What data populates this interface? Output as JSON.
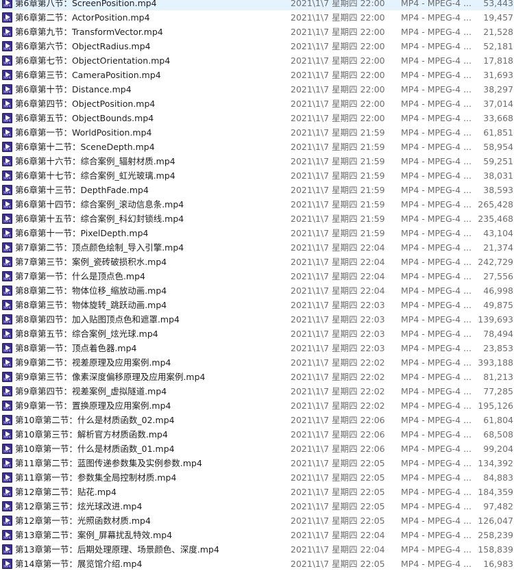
{
  "files": [
    {
      "name": "第6章第八节：ScreenPosition.mp4",
      "date": "2021\\1\\7 星期四 22:00",
      "type": "MP4 - MPEG-4 ...",
      "size": "53,443"
    },
    {
      "name": "第6章第二节：ActorPosition.mp4",
      "date": "2021\\1\\7 星期四 22:00",
      "type": "MP4 - MPEG-4 ...",
      "size": "19,457"
    },
    {
      "name": "第6章第九节：TransformVector.mp4",
      "date": "2021\\1\\7 星期四 22:00",
      "type": "MP4 - MPEG-4 ...",
      "size": "21,528"
    },
    {
      "name": "第6章第六节：ObjectRadius.mp4",
      "date": "2021\\1\\7 星期四 22:00",
      "type": "MP4 - MPEG-4 ...",
      "size": "52,181"
    },
    {
      "name": "第6章第七节：ObjectOrientation.mp4",
      "date": "2021\\1\\7 星期四 22:00",
      "type": "MP4 - MPEG-4 ...",
      "size": "17,818"
    },
    {
      "name": "第6章第三节：CameraPosition.mp4",
      "date": "2021\\1\\7 星期四 22:00",
      "type": "MP4 - MPEG-4 ...",
      "size": "31,693"
    },
    {
      "name": "第6章第十节：Distance.mp4",
      "date": "2021\\1\\7 星期四 22:00",
      "type": "MP4 - MPEG-4 ...",
      "size": "38,297"
    },
    {
      "name": "第6章第四节：ObjectPosition.mp4",
      "date": "2021\\1\\7 星期四 22:00",
      "type": "MP4 - MPEG-4 ...",
      "size": "37,014"
    },
    {
      "name": "第6章第五节：ObjectBounds.mp4",
      "date": "2021\\1\\7 星期四 22:00",
      "type": "MP4 - MPEG-4 ...",
      "size": "33,668"
    },
    {
      "name": "第6章第一节：WorldPosition.mp4",
      "date": "2021\\1\\7 星期四 21:59",
      "type": "MP4 - MPEG-4 ...",
      "size": "61,851"
    },
    {
      "name": "第6章第十二节：SceneDepth.mp4",
      "date": "2021\\1\\7 星期四 21:59",
      "type": "MP4 - MPEG-4 ...",
      "size": "58,954"
    },
    {
      "name": "第6章第十六节：综合案例_辐射材质.mp4",
      "date": "2021\\1\\7 星期四 21:59",
      "type": "MP4 - MPEG-4 ...",
      "size": "59,251"
    },
    {
      "name": "第6章第十七节：综合案例_虹光玻璃.mp4",
      "date": "2021\\1\\7 星期四 21:59",
      "type": "MP4 - MPEG-4 ...",
      "size": "38,031"
    },
    {
      "name": "第6章第十三节：DepthFade.mp4",
      "date": "2021\\1\\7 星期四 21:59",
      "type": "MP4 - MPEG-4 ...",
      "size": "38,593"
    },
    {
      "name": "第6章第十四节：综合案例_滚动信息条.mp4",
      "date": "2021\\1\\7 星期四 21:59",
      "type": "MP4 - MPEG-4 ...",
      "size": "265,428"
    },
    {
      "name": "第6章第十五节：综合案例_科幻封锁线.mp4",
      "date": "2021\\1\\7 星期四 21:59",
      "type": "MP4 - MPEG-4 ...",
      "size": "235,468"
    },
    {
      "name": "第6章第十一节：PixelDepth.mp4",
      "date": "2021\\1\\7 星期四 21:59",
      "type": "MP4 - MPEG-4 ...",
      "size": "43,104"
    },
    {
      "name": "第7章第二节：顶点颜色绘制_导入引擎.mp4",
      "date": "2021\\1\\7 星期四 22:04",
      "type": "MP4 - MPEG-4 ...",
      "size": "21,374"
    },
    {
      "name": "第7章第三节：案例_瓷砖破损积水.mp4",
      "date": "2021\\1\\7 星期四 22:04",
      "type": "MP4 - MPEG-4 ...",
      "size": "242,729"
    },
    {
      "name": "第7章第一节：什么是顶点色.mp4",
      "date": "2021\\1\\7 星期四 22:04",
      "type": "MP4 - MPEG-4 ...",
      "size": "27,556"
    },
    {
      "name": "第8章第二节：物体位移_缩放动画.mp4",
      "date": "2021\\1\\7 星期四 22:04",
      "type": "MP4 - MPEG-4 ...",
      "size": "46,998"
    },
    {
      "name": "第8章第三节：物体旋转_跳跃动画.mp4",
      "date": "2021\\1\\7 星期四 22:03",
      "type": "MP4 - MPEG-4 ...",
      "size": "49,875"
    },
    {
      "name": "第8章第四节：加入贴图顶点色和遮罩.mp4",
      "date": "2021\\1\\7 星期四 22:03",
      "type": "MP4 - MPEG-4 ...",
      "size": "139,693"
    },
    {
      "name": "第8章第五节：综合案例_炫光球.mp4",
      "date": "2021\\1\\7 星期四 22:03",
      "type": "MP4 - MPEG-4 ...",
      "size": "78,494"
    },
    {
      "name": "第8章第一节：顶点着色器.mp4",
      "date": "2021\\1\\7 星期四 22:03",
      "type": "MP4 - MPEG-4 ...",
      "size": "23,853"
    },
    {
      "name": "第9章第二节：视差原理及应用案例.mp4",
      "date": "2021\\1\\7 星期四 22:02",
      "type": "MP4 - MPEG-4 ...",
      "size": "393,188"
    },
    {
      "name": "第9章第三节：像素深度偏移原理及应用案例.mp4",
      "date": "2021\\1\\7 星期四 22:02",
      "type": "MP4 - MPEG-4 ...",
      "size": "81,213"
    },
    {
      "name": "第9章第四节：视差案例_虚拟隧道.mp4",
      "date": "2021\\1\\7 星期四 22:02",
      "type": "MP4 - MPEG-4 ...",
      "size": "77,285"
    },
    {
      "name": "第9章第一节：置换原理及应用案例.mp4",
      "date": "2021\\1\\7 星期四 22:02",
      "type": "MP4 - MPEG-4 ...",
      "size": "195,126"
    },
    {
      "name": "第10章第二节：什么是材质函数_02.mp4",
      "date": "2021\\1\\7 星期四 22:06",
      "type": "MP4 - MPEG-4 ...",
      "size": "61,804"
    },
    {
      "name": "第10章第三节：解析官方材质函数.mp4",
      "date": "2021\\1\\7 星期四 22:06",
      "type": "MP4 - MPEG-4 ...",
      "size": "68,508"
    },
    {
      "name": "第10章第一节：什么是材质函数_01.mp4",
      "date": "2021\\1\\7 星期四 22:06",
      "type": "MP4 - MPEG-4 ...",
      "size": "99,204"
    },
    {
      "name": "第11章第二节：蓝图传递参数集及实例参数.mp4",
      "date": "2021\\1\\7 星期四 22:05",
      "type": "MP4 - MPEG-4 ...",
      "size": "134,392"
    },
    {
      "name": "第11章第一节：参数集全局控制材质.mp4",
      "date": "2021\\1\\7 星期四 22:05",
      "type": "MP4 - MPEG-4 ...",
      "size": "84,883"
    },
    {
      "name": "第12章第二节：贴花.mp4",
      "date": "2021\\1\\7 星期四 22:05",
      "type": "MP4 - MPEG-4 ...",
      "size": "184,359"
    },
    {
      "name": "第12章第三节：炫光球改进.mp4",
      "date": "2021\\1\\7 星期四 22:05",
      "type": "MP4 - MPEG-4 ...",
      "size": "97,482"
    },
    {
      "name": "第12章第一节：光照函数材质.mp4",
      "date": "2021\\1\\7 星期四 22:05",
      "type": "MP4 - MPEG-4 ...",
      "size": "126,047"
    },
    {
      "name": "第13章第二节：案例_屏幕扰乱特效.mp4",
      "date": "2021\\1\\7 星期四 22:04",
      "type": "MP4 - MPEG-4 ...",
      "size": "258,239"
    },
    {
      "name": "第13章第一节：后期处理原理、场景颜色、深度.mp4",
      "date": "2021\\1\\7 星期四 22:04",
      "type": "MP4 - MPEG-4 ...",
      "size": "158,839"
    },
    {
      "name": "第14章第一节：展览馆介绍.mp4",
      "date": "2021\\1\\7 星期四 22:05",
      "type": "MP4 - MPEG-4 ...",
      "size": "16,983"
    }
  ]
}
